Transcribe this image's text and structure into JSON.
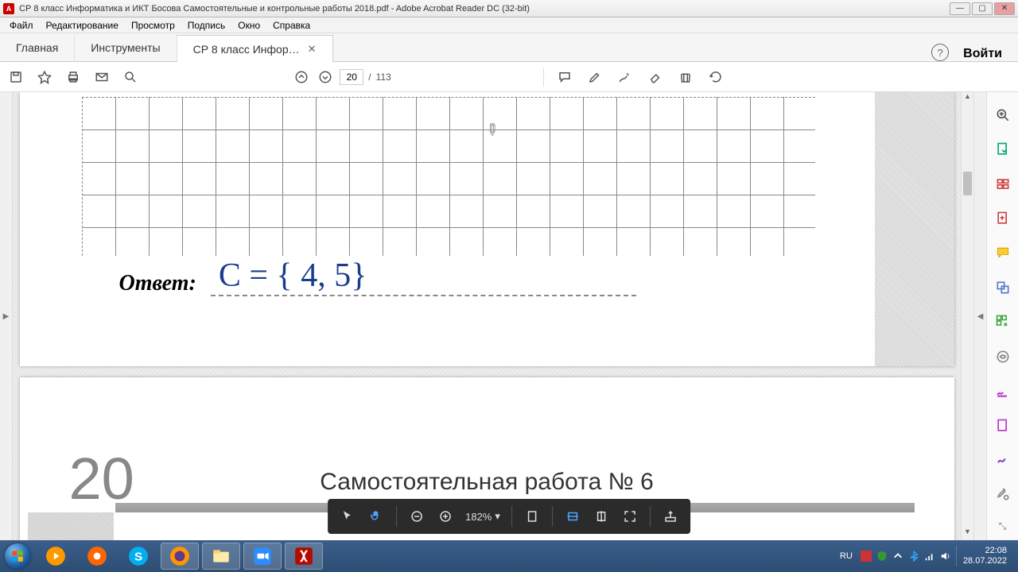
{
  "window": {
    "title": "СР 8 класс Информатика и ИКТ Босова Самостоятельные и контрольные работы 2018.pdf - Adobe Acrobat Reader DC (32-bit)"
  },
  "menu": {
    "file": "Файл",
    "edit": "Редактирование",
    "view": "Просмотр",
    "sign": "Подпись",
    "window": "Окно",
    "help": "Справка"
  },
  "tabs": {
    "home": "Главная",
    "tools": "Инструменты",
    "doc": "СР 8 класс Инфор…",
    "login": "Войти"
  },
  "toolbar": {
    "page_current": "20",
    "page_sep": "/",
    "page_total": "113"
  },
  "page_controls": {
    "zoom": "182%"
  },
  "document": {
    "answer_label": "Ответ:",
    "handwritten": "C = { 4, 5}",
    "page_number": "20",
    "section_title": "Самостоятельная  работа  № 6"
  },
  "taskbar": {
    "lang": "RU",
    "time": "22:08",
    "date": "28.07.2022"
  }
}
